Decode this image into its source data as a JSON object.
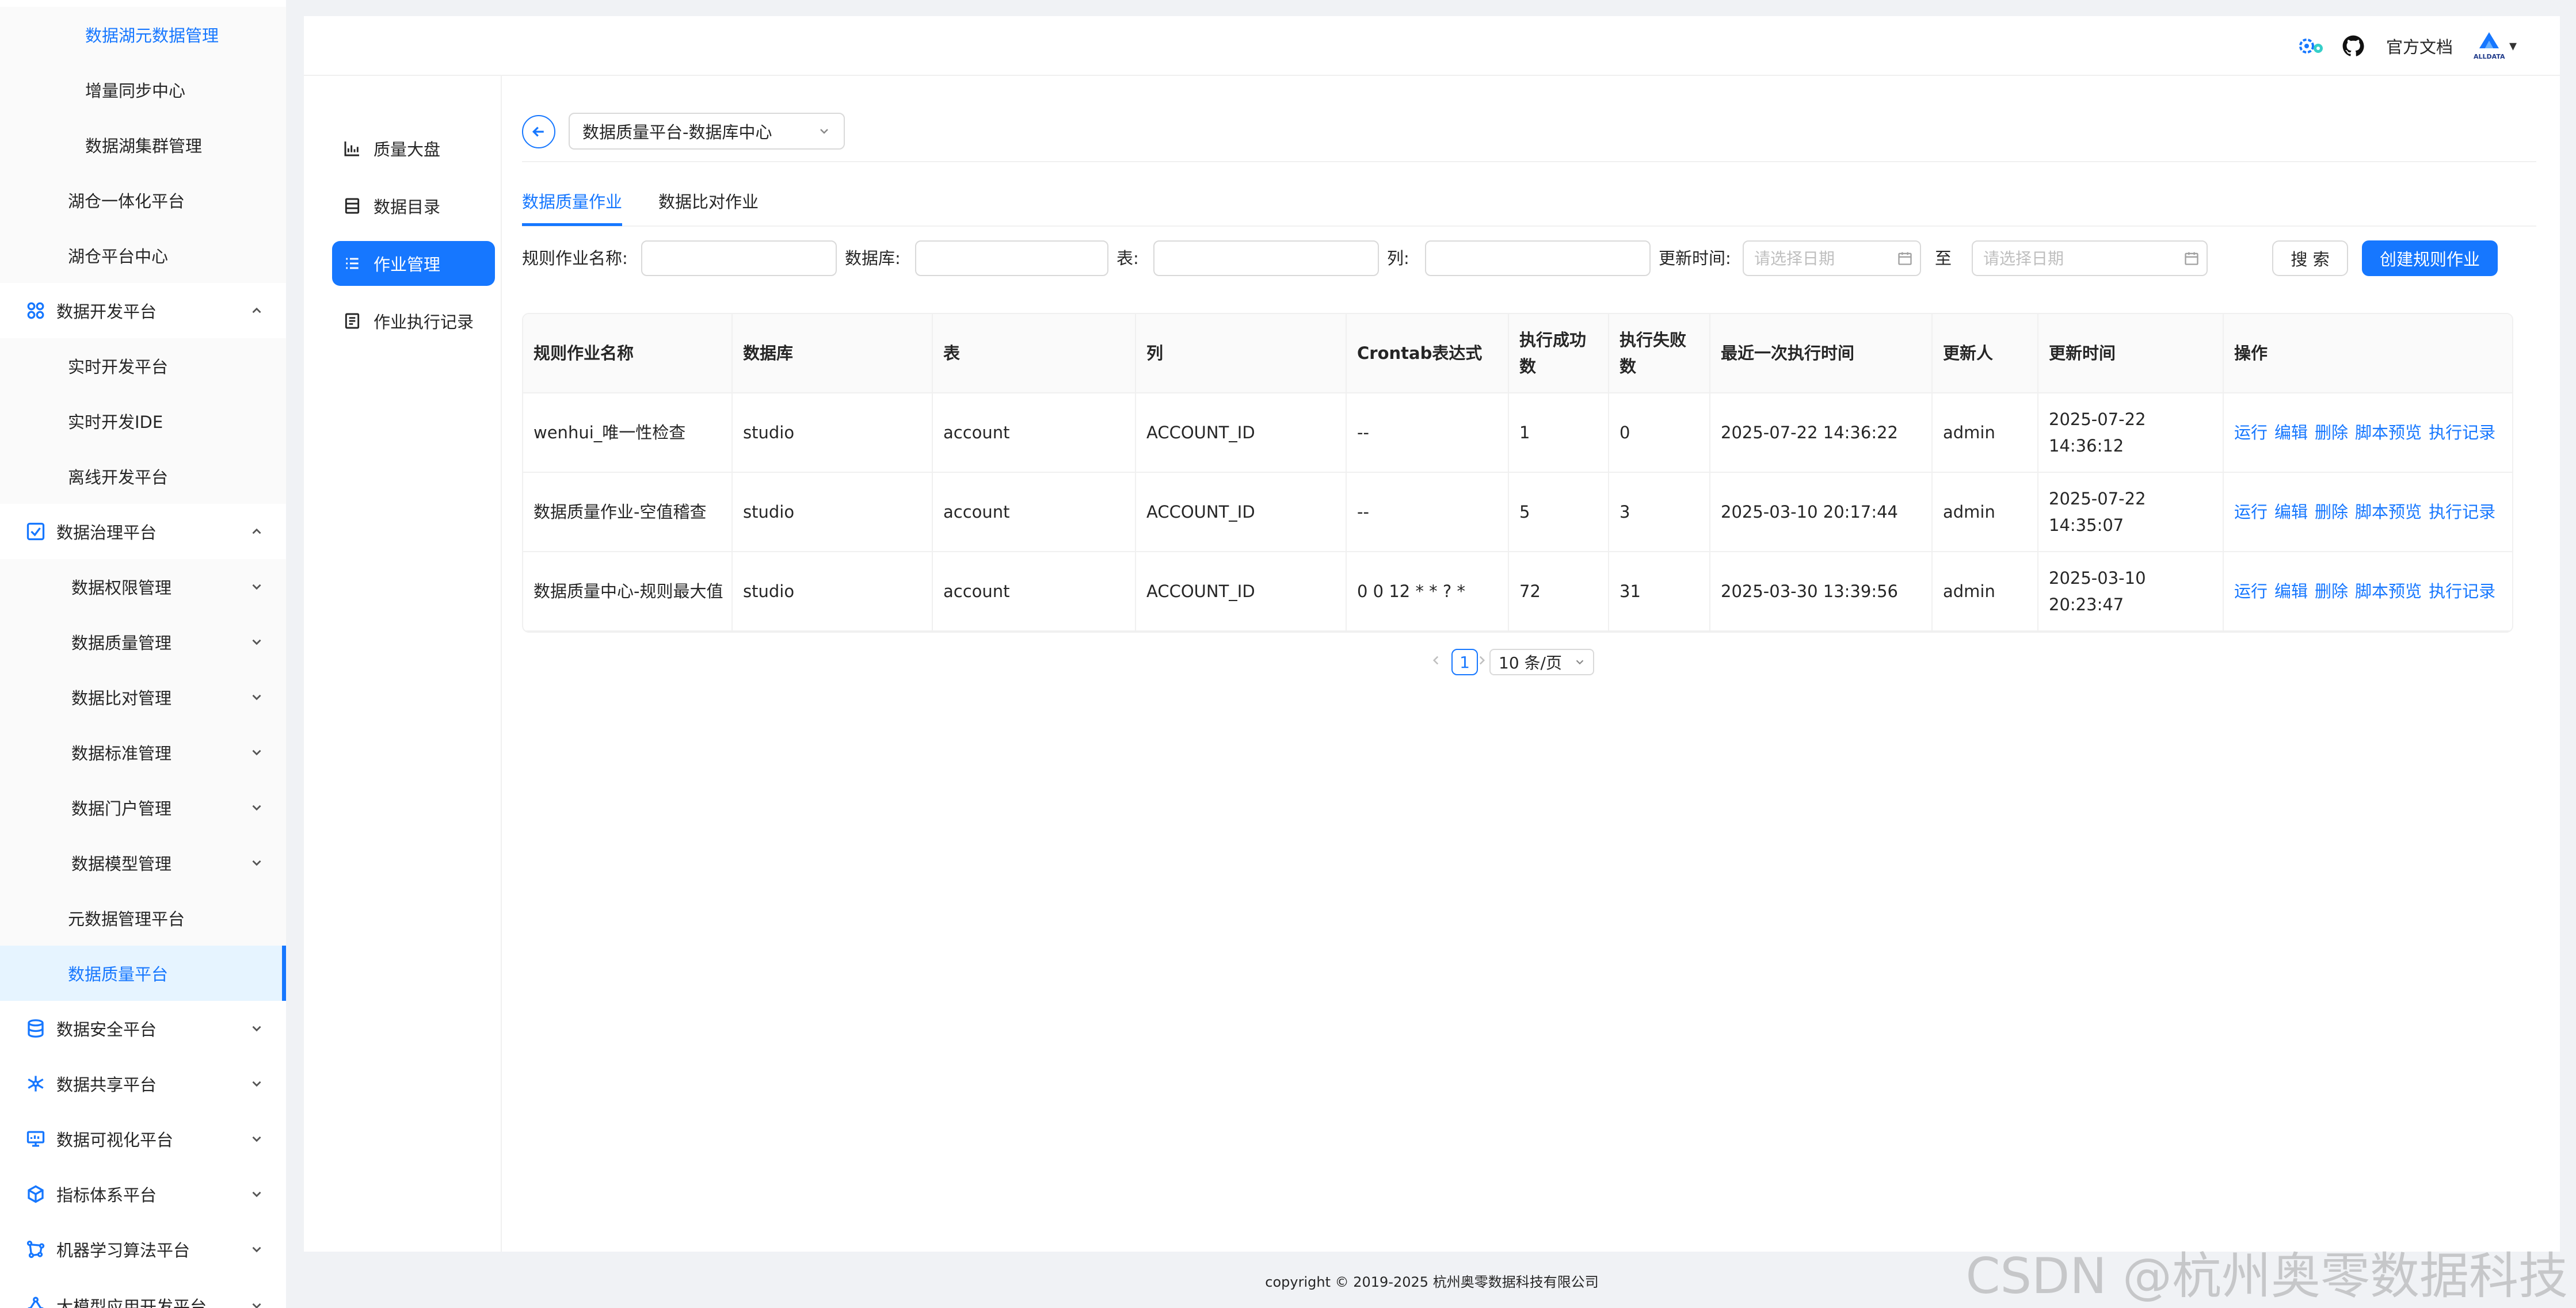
{
  "left_nav": {
    "items": [
      {
        "label": "数据湖元数据管理",
        "icon": ""
      },
      {
        "label": "增量同步中心",
        "icon": ""
      },
      {
        "label": "数据湖集群管理",
        "icon": ""
      },
      {
        "label": "湖仓一体化平台",
        "icon": ""
      },
      {
        "label": "湖仓平台中心",
        "icon": ""
      },
      {
        "label": "数据开发平台",
        "icon": "grid-icon"
      },
      {
        "label": "实时开发平台",
        "icon": ""
      },
      {
        "label": "实时开发IDE",
        "icon": ""
      },
      {
        "label": "离线开发平台",
        "icon": ""
      },
      {
        "label": "数据治理平台",
        "icon": "checkbox-icon"
      },
      {
        "label": "数据权限管理",
        "icon": ""
      },
      {
        "label": "数据质量管理",
        "icon": ""
      },
      {
        "label": "数据比对管理",
        "icon": ""
      },
      {
        "label": "数据标准管理",
        "icon": ""
      },
      {
        "label": "数据门户管理",
        "icon": ""
      },
      {
        "label": "数据模型管理",
        "icon": ""
      },
      {
        "label": "元数据管理平台",
        "icon": ""
      },
      {
        "label": "数据质量平台",
        "icon": ""
      },
      {
        "label": "数据安全平台",
        "icon": "database-icon"
      },
      {
        "label": "数据共享平台",
        "icon": "share-icon"
      },
      {
        "label": "数据可视化平台",
        "icon": "monitor-icon"
      },
      {
        "label": "指标体系平台",
        "icon": "cube-icon"
      },
      {
        "label": "机器学习算法平台",
        "icon": "ml-icon"
      },
      {
        "label": "大模型应用开发平台",
        "icon": "llm-icon"
      }
    ]
  },
  "topbar": {
    "docs_label": "官方文档",
    "logo_text": "ALLDATA",
    "dropdown_glyph": "▾"
  },
  "submenu": {
    "items": [
      {
        "label": "质量大盘",
        "icon": "bar-chart-icon"
      },
      {
        "label": "数据目录",
        "icon": "catalog-icon"
      },
      {
        "label": "作业管理",
        "icon": "list-icon"
      },
      {
        "label": "作业执行记录",
        "icon": "record-icon"
      }
    ]
  },
  "content": {
    "db_select_value": "数据质量平台-数据库中心",
    "tabs": [
      {
        "label": "数据质量作业"
      },
      {
        "label": "数据比对作业"
      }
    ],
    "filters": {
      "job_name_label": "规则作业名称:",
      "database_label": "数据库:",
      "table_label": "表:",
      "column_label": "列:",
      "update_time_label": "更新时间:",
      "date_placeholder_start": "请选择日期",
      "to_label": "至",
      "date_placeholder_end": "请选择日期",
      "search_label": "搜 索",
      "create_label": "创建规则作业"
    },
    "table": {
      "headers": [
        "规则作业名称",
        "数据库",
        "表",
        "列",
        "Crontab表达式",
        "执行成功数",
        "执行失败数",
        "最近一次执行时间",
        "更新人",
        "更新时间",
        "操作"
      ],
      "rows": [
        [
          "wenhui_唯一性检查",
          "studio",
          "account",
          "ACCOUNT_ID",
          "--",
          "1",
          "0",
          "2025-07-22 14:36:22",
          "admin",
          "2025-07-22 14:36:12"
        ],
        [
          "数据质量作业-空值稽查",
          "studio",
          "account",
          "ACCOUNT_ID",
          "--",
          "5",
          "3",
          "2025-03-10 20:17:44",
          "admin",
          "2025-07-22 14:35:07"
        ],
        [
          "数据质量中心-规则最大值",
          "studio",
          "account",
          "ACCOUNT_ID",
          "0 0 12 * * ? *",
          "72",
          "31",
          "2025-03-30 13:39:56",
          "admin",
          "2025-03-10 20:23:47"
        ]
      ],
      "actions": [
        "运行",
        "编辑",
        "删除",
        "脚本预览",
        "执行记录"
      ]
    },
    "pagination": {
      "current_page": "1",
      "page_size": "10 条/页"
    }
  },
  "footer": {
    "copyright": "copyright © 2019-2025 杭州奥零数据科技有限公司"
  },
  "watermark": "CSDN @杭州奥零数据科技",
  "colors": {
    "accent": "#1677ff",
    "active_bg": "#e6f4ff",
    "border": "#d9d9d9"
  }
}
